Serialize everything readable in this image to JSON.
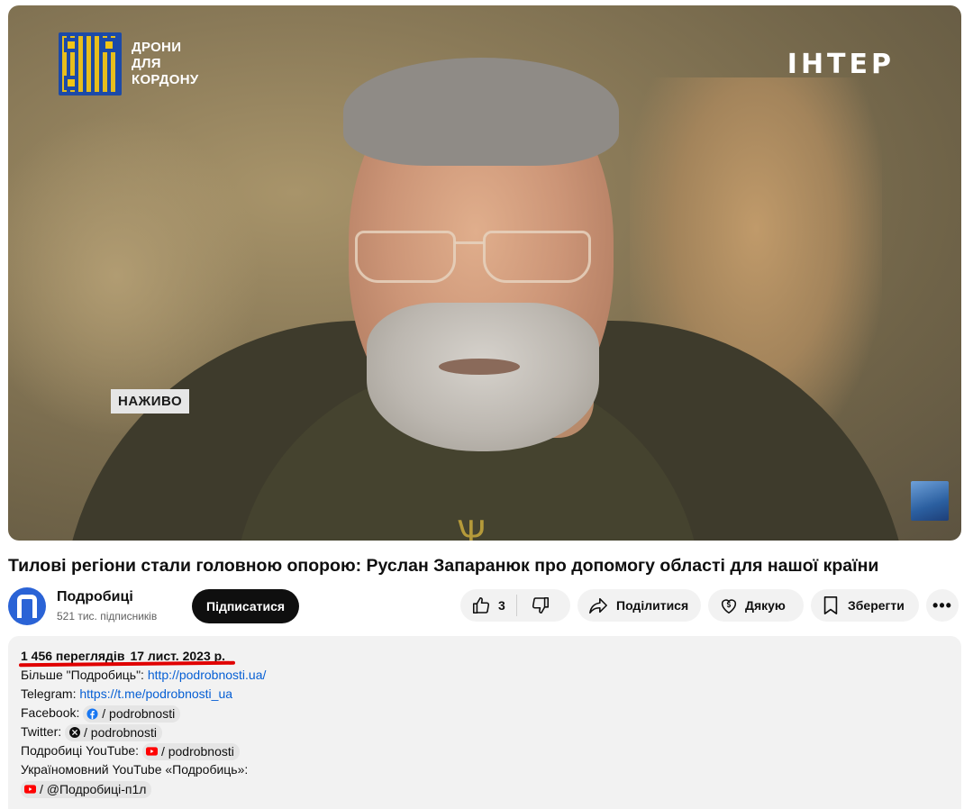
{
  "player": {
    "promo_text": "ДРОНИ\nДЛЯ\nКОРДОНУ",
    "channel_logo": "ІНТЕР",
    "live_badge": "НАЖИВО"
  },
  "video": {
    "title": "Тилові регіони стали головною опорою: Руслан Запаранюк про допомогу області для нашої країни"
  },
  "owner": {
    "channel_name": "Подробиці",
    "subscribers": "521 тис. підписників",
    "subscribe_label": "Підписатися"
  },
  "actions": {
    "like_count": "3",
    "share_label": "Поділитися",
    "thanks_label": "Дякую",
    "save_label": "Зберегти",
    "more_label": "•••"
  },
  "description": {
    "views": "1 456 переглядів",
    "date": "17 лист. 2023 р.",
    "lines": [
      {
        "prefix": "Більше \"Подробиць\": ",
        "link": "http://podrobnosti.ua/"
      },
      {
        "prefix": "Telegram: ",
        "link": "https://t.me/podrobnosti_ua"
      }
    ],
    "facebook": {
      "label": "Facebook:",
      "handle": "/ podrobnosti"
    },
    "twitter": {
      "label": "Twitter:",
      "handle": "/ podrobnosti"
    },
    "youtube": {
      "label": "Подробиці YouTube:",
      "handle": "/ podrobnosti"
    },
    "ua_youtube_label": "Україномовний YouTube «Подробиць»:",
    "ua_youtube_handle": "/ @Подробиці-п1л"
  },
  "colors": {
    "accent_red": "#e00000",
    "link_blue": "#065fd4",
    "avatar_blue": "#2a63d6"
  }
}
